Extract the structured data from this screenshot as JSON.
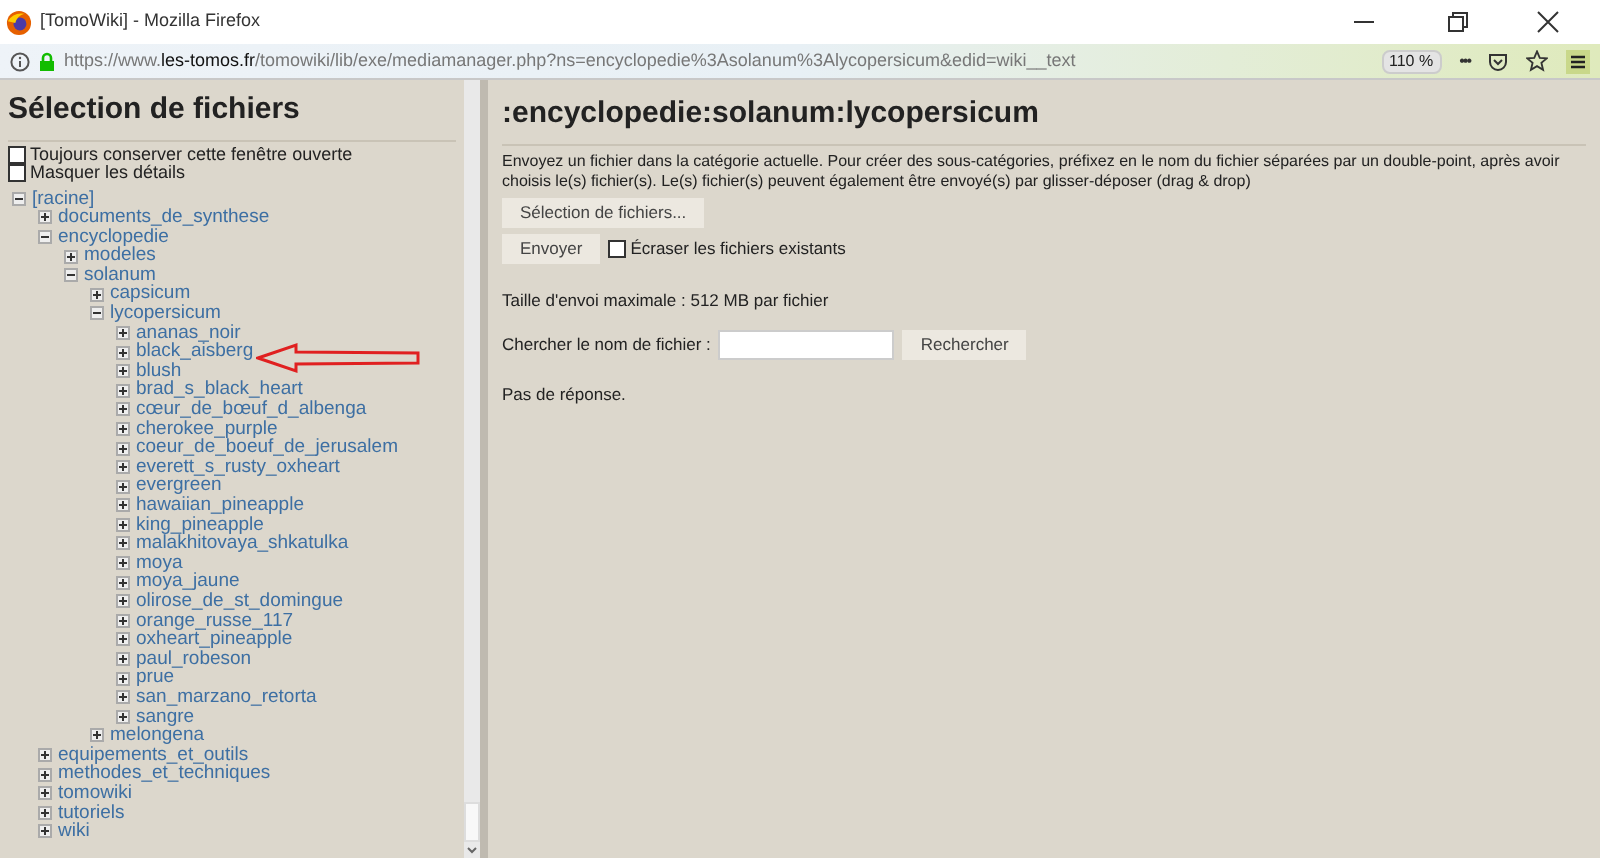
{
  "browser": {
    "title": "[TomoWiki] - Mozilla Firefox",
    "url": "https://www.**les-tomos.fr**/tomowiki/lib/exe/mediamanager.php?ns=encyclopedie%3Asolanum%3Alycopersicum&edid=wiki__text",
    "zoom": "110 %",
    "menu_dots": "•••"
  },
  "sidebar": {
    "title": "Sélection de fichiers",
    "options": [
      {
        "label": "Toujours conserver cette fenêtre ouverte",
        "checked": false
      },
      {
        "label": "Masquer les détails",
        "checked": false
      }
    ],
    "tree": [
      {
        "label": "[racine]",
        "expanded": true,
        "children": [
          {
            "label": "documents_de_synthese",
            "expanded": false
          },
          {
            "label": "encyclopedie",
            "expanded": true,
            "children": [
              {
                "label": "modeles",
                "expanded": false
              },
              {
                "label": "solanum",
                "expanded": true,
                "children": [
                  {
                    "label": "capsicum",
                    "expanded": false
                  },
                  {
                    "label": "lycopersicum",
                    "expanded": true,
                    "children": [
                      {
                        "label": "ananas_noir",
                        "expanded": false
                      },
                      {
                        "label": "black_aisberg",
                        "expanded": false
                      },
                      {
                        "label": "blush",
                        "expanded": false
                      },
                      {
                        "label": "brad_s_black_heart",
                        "expanded": false
                      },
                      {
                        "label": "cœur_de_bœuf_d_albenga",
                        "expanded": false
                      },
                      {
                        "label": "cherokee_purple",
                        "expanded": false
                      },
                      {
                        "label": "coeur_de_boeuf_de_jerusalem",
                        "expanded": false
                      },
                      {
                        "label": "everett_s_rusty_oxheart",
                        "expanded": false
                      },
                      {
                        "label": "evergreen",
                        "expanded": false
                      },
                      {
                        "label": "hawaiian_pineapple",
                        "expanded": false
                      },
                      {
                        "label": "king_pineapple",
                        "expanded": false
                      },
                      {
                        "label": "malakhitovaya_shkatulka",
                        "expanded": false
                      },
                      {
                        "label": "moya",
                        "expanded": false
                      },
                      {
                        "label": "moya_jaune",
                        "expanded": false
                      },
                      {
                        "label": "olirose_de_st_domingue",
                        "expanded": false
                      },
                      {
                        "label": "orange_russe_117",
                        "expanded": false
                      },
                      {
                        "label": "oxheart_pineapple",
                        "expanded": false
                      },
                      {
                        "label": "paul_robeson",
                        "expanded": false
                      },
                      {
                        "label": "prue",
                        "expanded": false
                      },
                      {
                        "label": "san_marzano_retorta",
                        "expanded": false
                      },
                      {
                        "label": "sangre",
                        "expanded": false
                      }
                    ]
                  },
                  {
                    "label": "melongena",
                    "expanded": false
                  }
                ]
              }
            ]
          },
          {
            "label": "equipements_et_outils",
            "expanded": false
          },
          {
            "label": "methodes_et_techniques",
            "expanded": false
          },
          {
            "label": "tomowiki",
            "expanded": false
          },
          {
            "label": "tutoriels",
            "expanded": false
          },
          {
            "label": "wiki",
            "expanded": false
          }
        ]
      }
    ]
  },
  "main": {
    "title": ":encyclopedie:solanum:lycopersicum",
    "intro": "Envoyez un fichier dans la catégorie actuelle. Pour créer des sous-catégories, préfixez en le nom du fichier séparées par un double-point, après avoir choisis le(s) fichier(s). Le(s) fichier(s) peuvent également être envoyé(s) par glisser-déposer (drag & drop)",
    "select_button": "Sélection de fichiers...",
    "upload_button": "Envoyer",
    "overwrite": {
      "label": "Écraser les fichiers existants",
      "checked": false
    },
    "max_size": "Taille d'envoi maximale : 512 MB par fichier",
    "search": {
      "label": "Chercher le nom de fichier :",
      "button": "Rechercher"
    },
    "result": "Pas de réponse."
  }
}
